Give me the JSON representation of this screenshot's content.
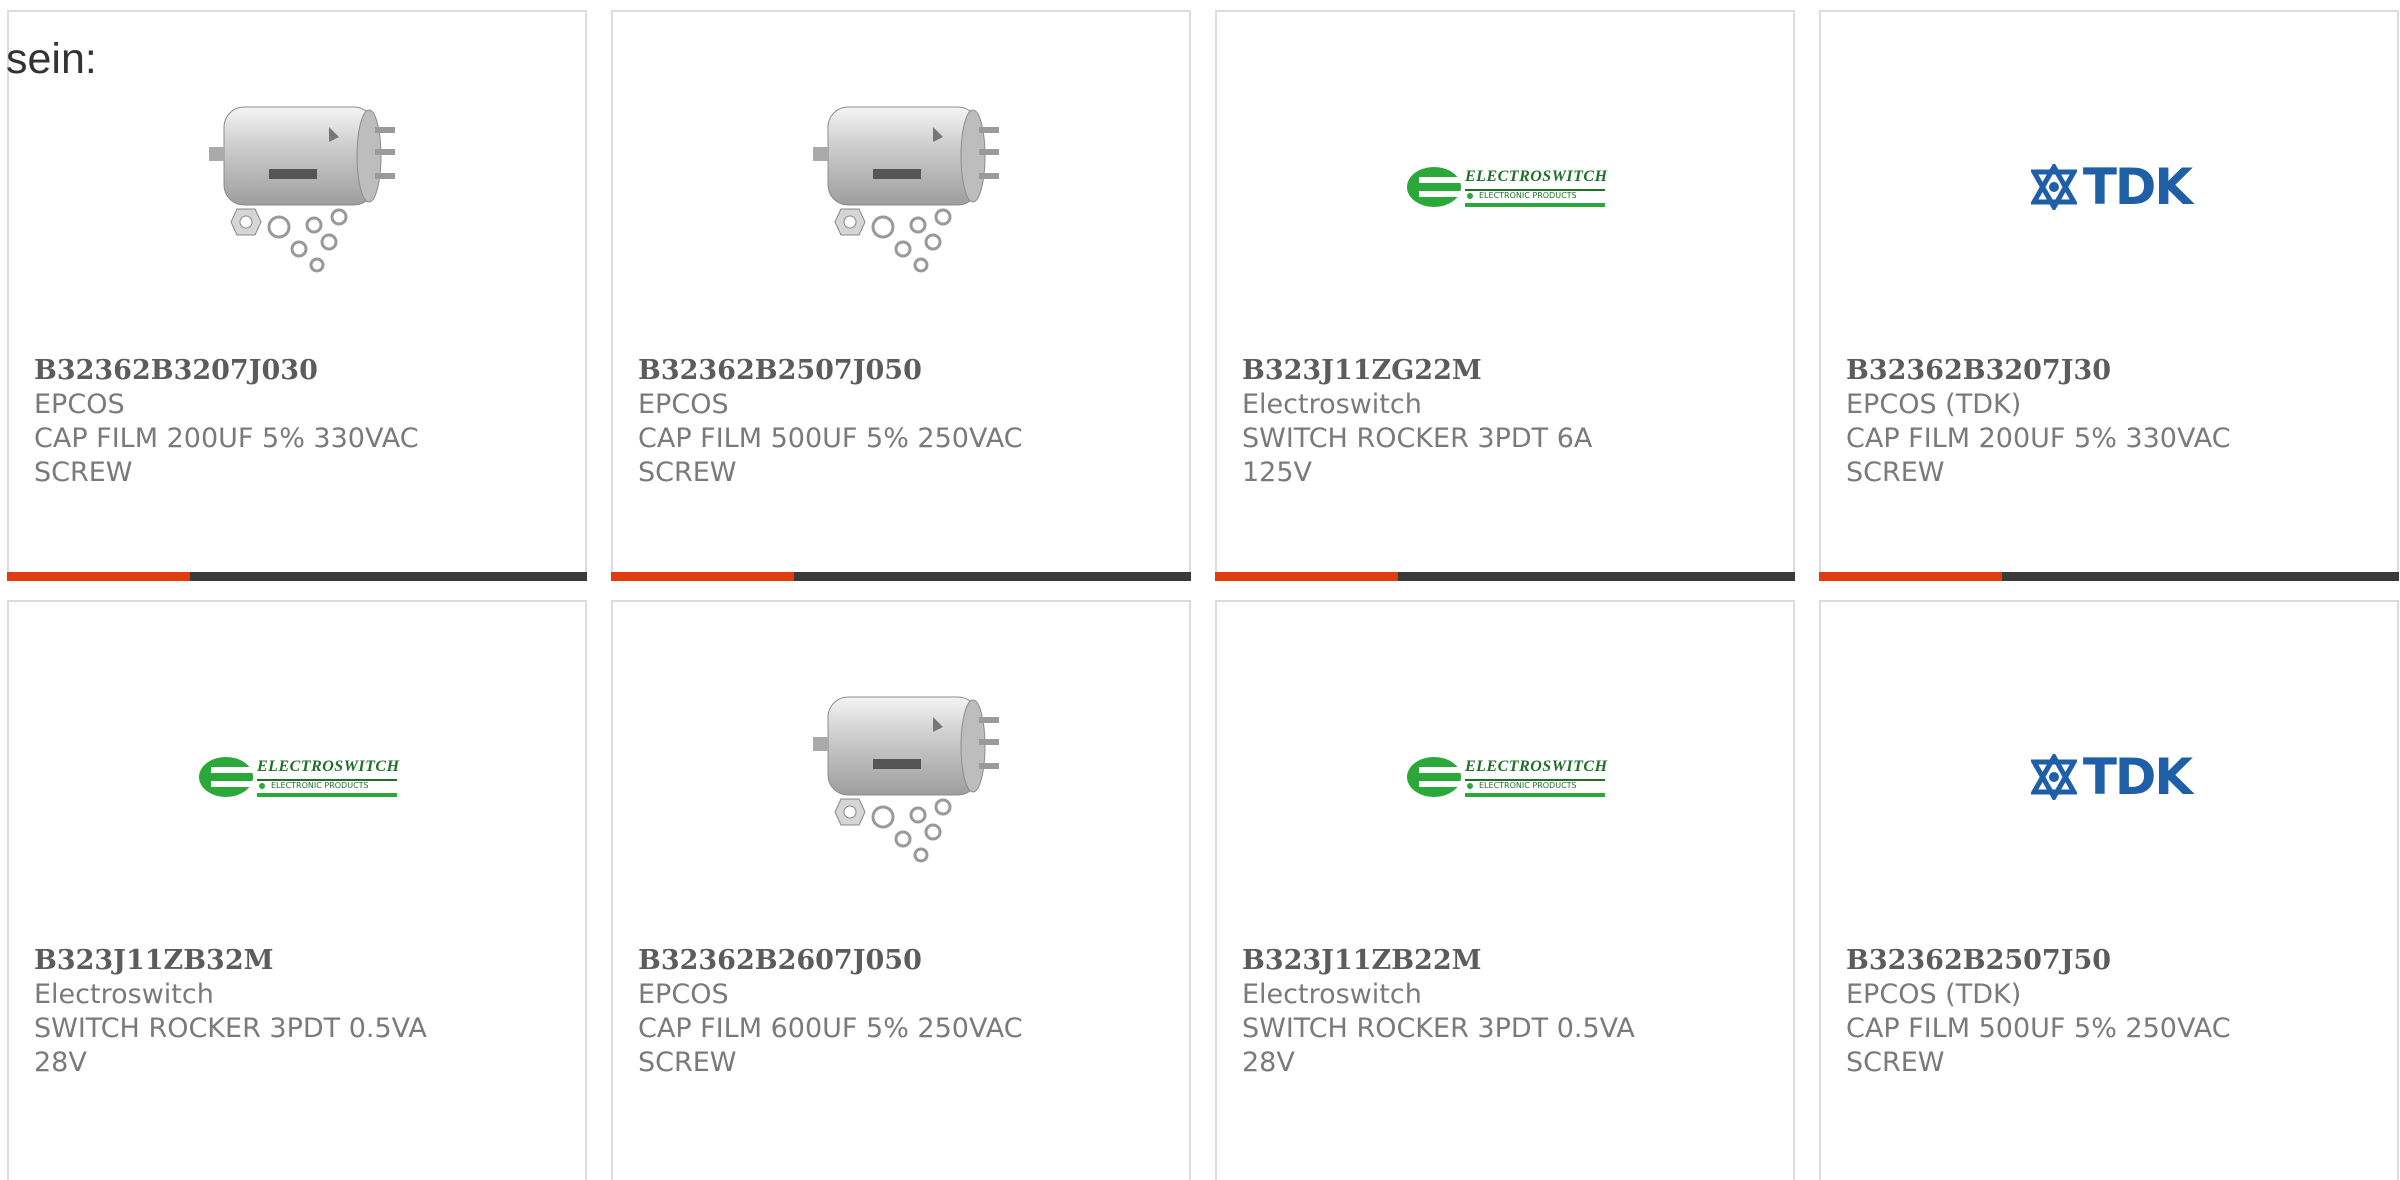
{
  "intro_text": "sein:",
  "colors": {
    "accent": "#e03d0e",
    "bar_dark": "#3a3a3a",
    "border": "#dcdcdc",
    "text": "#6b6b6b"
  },
  "products": [
    {
      "part_number": "B32362B3207J030",
      "manufacturer": "EPCOS",
      "description": "CAP FILM 200UF 5% 330VAC SCREW",
      "image": "capacitor-photo"
    },
    {
      "part_number": "B32362B2507J050",
      "manufacturer": "EPCOS",
      "description": "CAP FILM 500UF 5% 250VAC SCREW",
      "image": "capacitor-photo"
    },
    {
      "part_number": "B323J11ZG22M",
      "manufacturer": "Electroswitch",
      "description": "SWITCH ROCKER 3PDT 6A 125V",
      "image": "electroswitch-logo"
    },
    {
      "part_number": "B32362B3207J30",
      "manufacturer": "EPCOS (TDK)",
      "description": "CAP FILM 200UF 5% 330VAC SCREW",
      "image": "tdk-logo"
    },
    {
      "part_number": "B323J11ZB32M",
      "manufacturer": "Electroswitch",
      "description": "SWITCH ROCKER 3PDT 0.5VA 28V",
      "image": "electroswitch-logo"
    },
    {
      "part_number": "B32362B2607J050",
      "manufacturer": "EPCOS",
      "description": "CAP FILM 600UF 5% 250VAC SCREW",
      "image": "capacitor-photo"
    },
    {
      "part_number": "B323J11ZB22M",
      "manufacturer": "Electroswitch",
      "description": "SWITCH ROCKER 3PDT 0.5VA 28V",
      "image": "electroswitch-logo"
    },
    {
      "part_number": "B32362B2507J50",
      "manufacturer": "EPCOS (TDK)",
      "description": "CAP FILM 500UF 5% 250VAC SCREW",
      "image": "tdk-logo"
    }
  ],
  "logos": {
    "electroswitch_name": "ELECTROSWITCH",
    "electroswitch_tagline": "ELECTRONIC PRODUCTS",
    "tdk_name": "TDK"
  }
}
